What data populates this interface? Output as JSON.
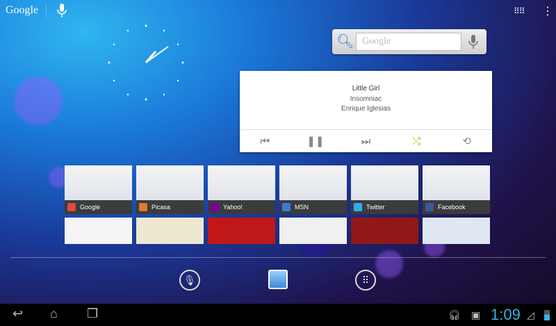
{
  "top_bar": {
    "google_label": "Google",
    "voice_icon": "mic-icon",
    "apps_icon": "grid-icon",
    "menu_icon": "overflow-menu-icon"
  },
  "search_widget": {
    "placeholder": "Google"
  },
  "music_widget": {
    "title": "Little Girl",
    "album": "Insomniac",
    "artist": "Enrique Iglesias",
    "shuffle_color": "#99cc00"
  },
  "bookmarks": [
    {
      "label": "Google",
      "color": "#dd4b39"
    },
    {
      "label": "Picasa",
      "color": "#e0792b"
    },
    {
      "label": "Yahoo!",
      "color": "#7b0099"
    },
    {
      "label": "MSN",
      "color": "#3a7bd5"
    },
    {
      "label": "Twitter",
      "color": "#33aaee"
    },
    {
      "label": "Facebook",
      "color": "#3b5998"
    }
  ],
  "status_bar": {
    "time": "1:09",
    "accent": "#33b5e5"
  }
}
